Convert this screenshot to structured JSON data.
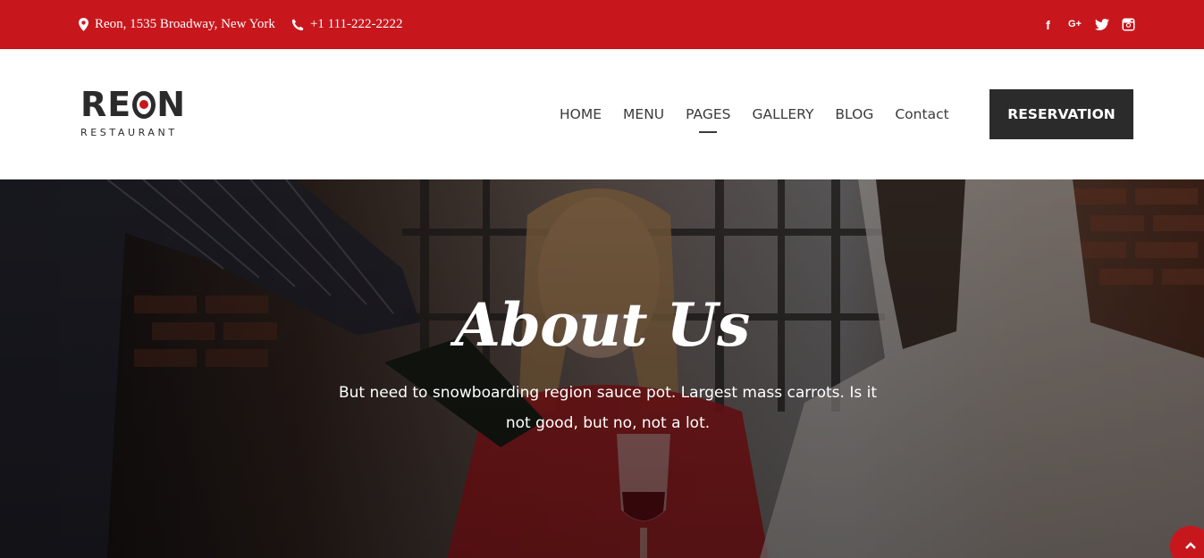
{
  "topbar": {
    "address": "Reon, 1535 Broadway, New York",
    "phone": "+1 111-222-2222",
    "social": [
      {
        "icon": "facebook-icon",
        "glyph": "f"
      },
      {
        "icon": "google-plus-icon",
        "glyph": "G+"
      },
      {
        "icon": "twitter-icon",
        "glyph": ""
      },
      {
        "icon": "instagram-icon",
        "glyph": ""
      }
    ]
  },
  "header": {
    "logo": {
      "wordmark_start": "RE",
      "wordmark_end": "N",
      "tagline": "RESTAURANT"
    },
    "nav": [
      {
        "label": "HOME",
        "active": false
      },
      {
        "label": "MENU",
        "active": false
      },
      {
        "label": "PAGES",
        "active": true
      },
      {
        "label": "GALLERY",
        "active": false
      },
      {
        "label": "BLOG",
        "active": false
      },
      {
        "label": "Contact",
        "active": false
      }
    ],
    "reservation_label": "RESERVATION"
  },
  "hero": {
    "title": "About Us",
    "text": "But need to snowboarding region sauce pot. Largest mass carrots. Is it not good, but no, not a lot."
  },
  "colors": {
    "brand_red": "#c8161d",
    "dark": "#2b2b2b",
    "white": "#ffffff"
  }
}
